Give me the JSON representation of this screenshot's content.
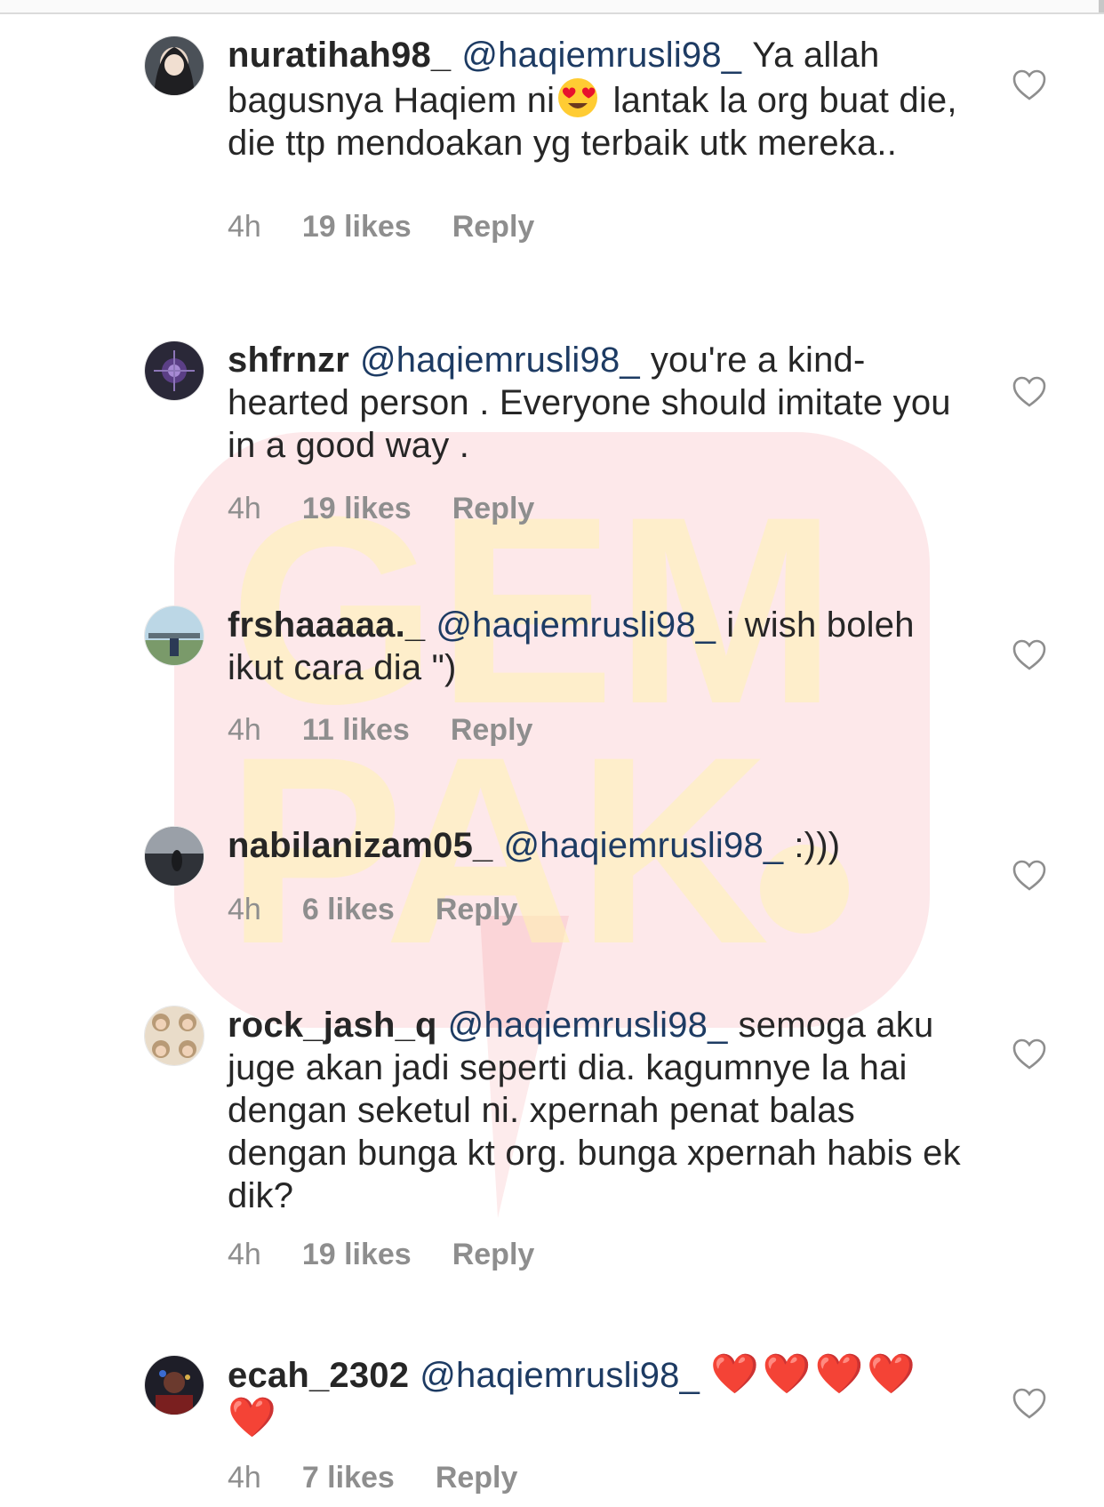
{
  "comments": [
    {
      "username": "nuratihah98_",
      "mention": "@haqiemrusli98_",
      "text_before": "Ya allah bagusnya Haqiem ni",
      "emoji": "heart-eyes",
      "text_after": " lantak la org buat die, die ttp mendoakan yg terbaik utk mereka..",
      "time": "4h",
      "likes": "19 likes",
      "reply": "Reply"
    },
    {
      "username": "shfrnzr",
      "mention": "@haqiemrusli98_",
      "text": "you're a kind-hearted person . Everyone should imitate you in a good way .",
      "time": "4h",
      "likes": "19 likes",
      "reply": "Reply"
    },
    {
      "username": "frshaaaaa._",
      "mention": "@haqiemrusli98_",
      "text": "i wish boleh ikut cara dia \")",
      "time": "4h",
      "likes": "11 likes",
      "reply": "Reply"
    },
    {
      "username": "nabilanizam05_",
      "mention": "@haqiemrusli98_",
      "text": ":)))",
      "time": "4h",
      "likes": "6 likes",
      "reply": "Reply"
    },
    {
      "username": "rock_jash_q",
      "mention": "@haqiemrusli98_",
      "text": "semoga aku juge akan jadi seperti dia. kagumnye la hai dengan seketul ni. xpernah penat balas dengan bunga kt org. bunga xpernah habis ek dik?",
      "time": "4h",
      "likes": "19 likes",
      "reply": "Reply"
    },
    {
      "username": "ecah_2302",
      "mention": "@haqiemrusli98_",
      "text": "❤️❤️❤️❤️❤️",
      "time": "4h",
      "likes": "7 likes",
      "reply": "Reply"
    }
  ],
  "icons": {
    "like": "heart-outline-icon"
  },
  "colors": {
    "text": "#262626",
    "mention": "#1d3b63",
    "meta": "#8e8e8e",
    "heart": "#ed1c24"
  },
  "watermark": {
    "line1": "GEM",
    "line2": "PAK"
  }
}
